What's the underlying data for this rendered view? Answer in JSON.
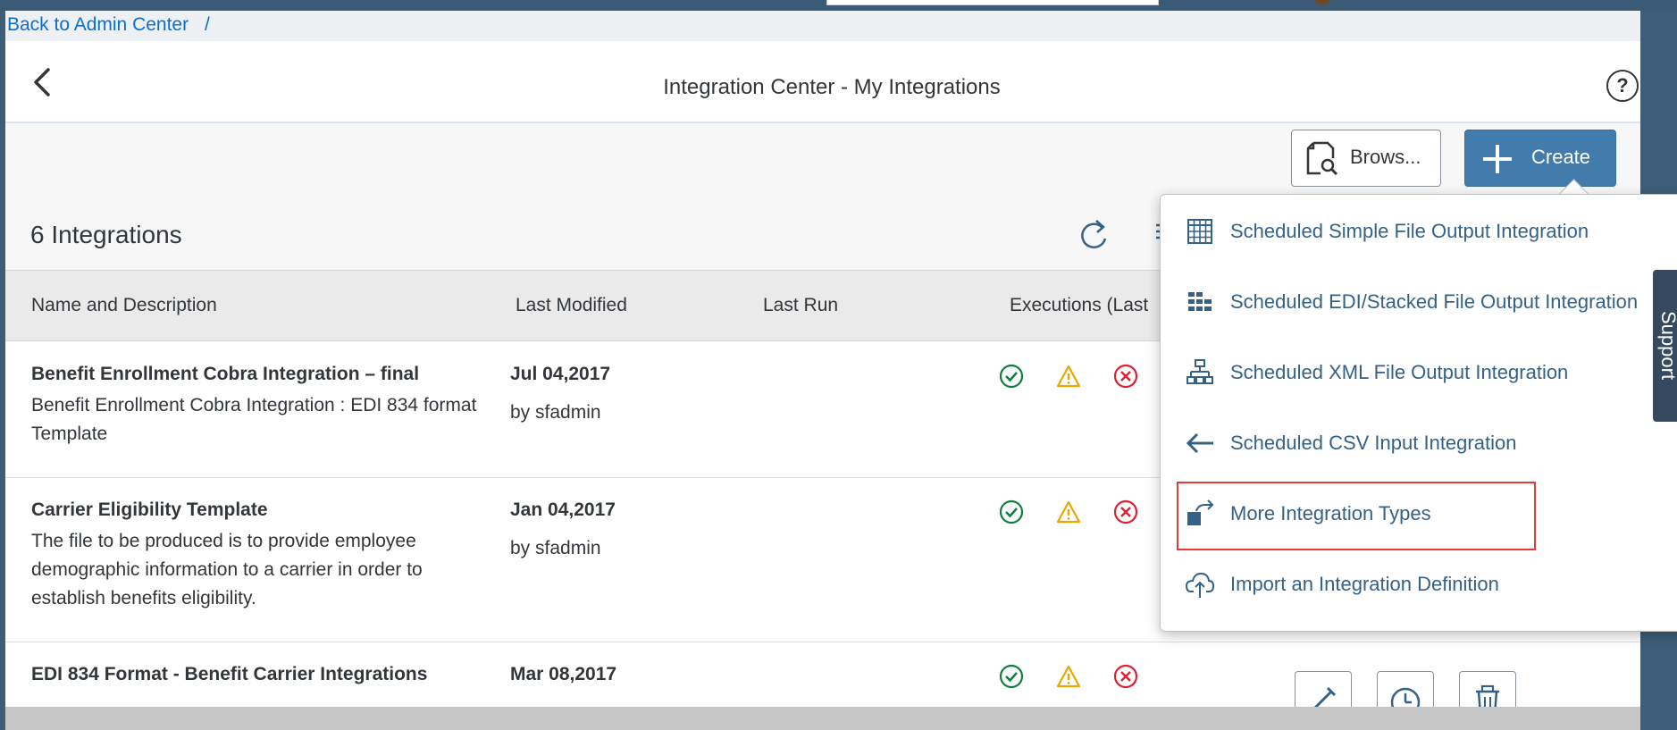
{
  "breadcrumb": {
    "back_link": "Back to Admin Center",
    "separator": "/"
  },
  "header": {
    "title": "Integration Center - My Integrations",
    "back_icon": "chevron-left-icon",
    "help_label": "?"
  },
  "toolbar": {
    "browse_label": "Brows...",
    "create_label": "Create"
  },
  "list": {
    "count_label": "6 Integrations"
  },
  "table": {
    "columns": [
      "Name and Description",
      "Last Modified",
      "Last Run",
      "Executions (Last"
    ],
    "rows": [
      {
        "name": "Benefit Enrollment Cobra Integration – final",
        "description": "Benefit Enrollment Cobra Integration : EDI 834 format Template",
        "modified_date": "Jul 04,2017",
        "modified_by": "by sfadmin"
      },
      {
        "name": "Carrier Eligibility Template",
        "description": "The file to be produced is to provide employee demographic information to a carrier in order to establish benefits eligibility.",
        "modified_date": "Jan 04,2017",
        "modified_by": "by sfadmin"
      },
      {
        "name": "EDI 834 Format - Benefit Carrier Integrations",
        "description": "",
        "modified_date": "Mar 08,2017",
        "modified_by": ""
      }
    ]
  },
  "create_menu": {
    "items": [
      {
        "label": "Scheduled Simple File Output Integration",
        "icon": "grid-table-icon"
      },
      {
        "label": "Scheduled EDI/Stacked File Output Integration",
        "icon": "stacked-grid-icon"
      },
      {
        "label": "Scheduled XML File Output Integration",
        "icon": "hierarchy-icon"
      },
      {
        "label": "Scheduled CSV Input Integration",
        "icon": "arrow-left-icon"
      },
      {
        "label": "More Integration Types",
        "icon": "export-box-icon"
      },
      {
        "label": "Import an Integration Definition",
        "icon": "cloud-upload-icon"
      }
    ]
  },
  "support_tab": {
    "label": "Support"
  },
  "colors": {
    "accent": "#427cac",
    "link": "#0a6ed1",
    "menu_text": "#346187",
    "success": "#107e3e",
    "warning": "#e9a700",
    "error": "#e0202f",
    "highlight": "#e63a3a"
  }
}
